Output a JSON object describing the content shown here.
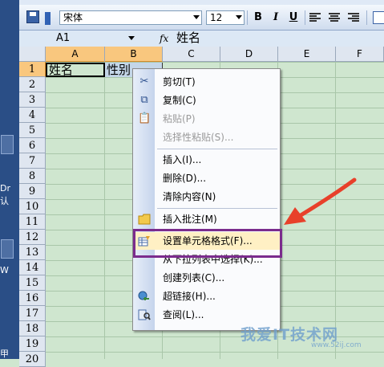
{
  "toolbar": {
    "font_name": "宋体",
    "font_size": "12",
    "bold_label": "B",
    "italic_label": "I",
    "underline_label": "U"
  },
  "formula_bar": {
    "name_box": "A1",
    "fx_label": "fx",
    "formula_value": "姓名"
  },
  "columns": [
    "A",
    "B",
    "C",
    "D",
    "E",
    "F"
  ],
  "rows": [
    "1",
    "2",
    "3",
    "4",
    "5",
    "6",
    "7",
    "8",
    "9",
    "10",
    "11",
    "12",
    "13",
    "14",
    "15",
    "16",
    "17",
    "18",
    "19",
    "20"
  ],
  "cells": {
    "a1": "姓名",
    "b1": "性别"
  },
  "context_menu": {
    "items": [
      {
        "label": "剪切(T)",
        "icon": "scissors-icon",
        "enabled": true
      },
      {
        "label": "复制(C)",
        "icon": "copy-icon",
        "enabled": true
      },
      {
        "label": "粘贴(P)",
        "icon": "paste-icon",
        "enabled": false
      },
      {
        "label": "选择性粘贴(S)...",
        "icon": "",
        "enabled": false
      },
      {
        "label": "插入(I)...",
        "icon": "",
        "enabled": true
      },
      {
        "label": "删除(D)...",
        "icon": "",
        "enabled": true
      },
      {
        "label": "清除内容(N)",
        "icon": "",
        "enabled": true
      },
      {
        "label": "插入批注(M)",
        "icon": "comment-icon",
        "enabled": true
      },
      {
        "label": "设置单元格格式(F)...",
        "icon": "format-cells-icon",
        "enabled": true,
        "highlighted": true
      },
      {
        "label": "从下拉列表中选择(K)...",
        "icon": "",
        "enabled": true
      },
      {
        "label": "创建列表(C)...",
        "icon": "",
        "enabled": true
      },
      {
        "label": "超链接(H)...",
        "icon": "hyperlink-icon",
        "enabled": true
      },
      {
        "label": "查阅(L)...",
        "icon": "research-icon",
        "enabled": true
      }
    ]
  },
  "desktop_strip": {
    "labels": [
      "Dr",
      "认",
      "W",
      "甲"
    ]
  },
  "watermark": {
    "main": "我爱IT技术网",
    "site": "www.52ij.com"
  },
  "colors": {
    "grid_bg": "#cfe6cf",
    "selected_header": "#f9c77e",
    "highlight_box": "#7b2c8d",
    "annotation_arrow": "#e8402a"
  }
}
